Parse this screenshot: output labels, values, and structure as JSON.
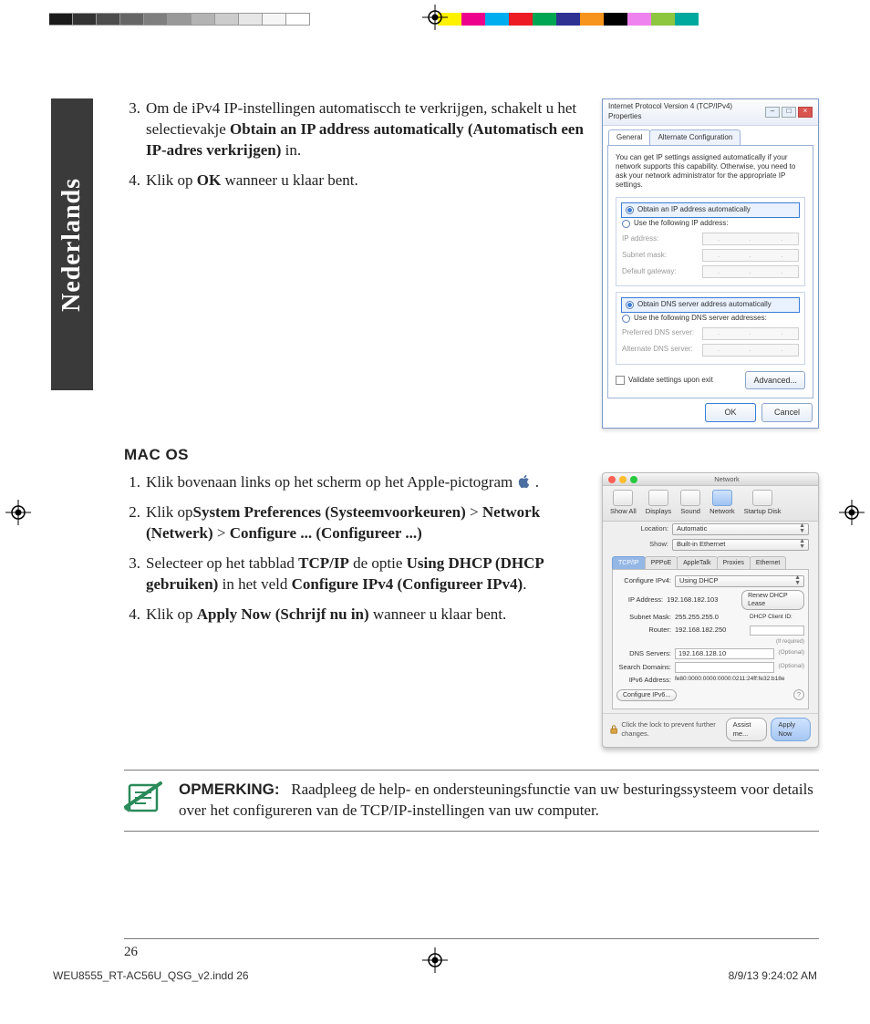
{
  "language_tab": "Nederlands",
  "page_number": "26",
  "win_section": {
    "step3_pre": "Om de iPv4 IP-instellingen automatiscch te verkrijgen, schakelt u het selectievakje ",
    "step3_bold": "Obtain an IP address automatically (Automatisch een IP-adres verkrijgen)",
    "step3_post": " in.",
    "step4_pre": "Klik op ",
    "step4_bold": "OK",
    "step4_post": " wanneer u klaar bent."
  },
  "mac_heading": "MAC OS",
  "mac_section": {
    "step1": "Klik bovenaan links op het scherm op het Apple-pictogram ",
    "step1_post": ".",
    "step2_pre": "Klik op",
    "step2_b1": "System Preferences (Systeemvoorkeuren)",
    "gt": " > ",
    "step2_b2": "Network (Netwerk)",
    "step2_b3": "Configure ... (Configureer ...)",
    "step3_pre": "Selecteer op het tabblad ",
    "step3_b1": "TCP/IP",
    "step3_mid": " de optie ",
    "step3_b2": "Using DHCP (DHCP gebruiken)",
    "step3_mid2": " in het veld ",
    "step3_b3": "Configure IPv4 (Configureer IPv4)",
    "step3_post": ".",
    "step4_pre": "Klik op ",
    "step4_b": "Apply Now (Schrijf nu in)",
    "step4_post": " wanneer u klaar bent."
  },
  "note": {
    "label": "OPMERKING:",
    "text": "Raadpleeg de help- en ondersteuningsfunctie van uw besturingssysteem voor details over het configureren van de TCP/IP-instellingen van uw computer."
  },
  "slug": {
    "file": "WEU8555_RT-AC56U_QSG_v2.indd   26",
    "timestamp": "8/9/13   9:24:02 AM"
  },
  "win_dialog": {
    "title": "Internet Protocol Version 4 (TCP/IPv4) Properties",
    "tab_general": "General",
    "tab_alt": "Alternate Configuration",
    "desc": "You can get IP settings assigned automatically if your network supports this capability. Otherwise, you need to ask your network administrator for the appropriate IP settings.",
    "r_obtain_ip": "Obtain an IP address automatically",
    "r_use_ip": "Use the following IP address:",
    "f_ip": "IP address:",
    "f_subnet": "Subnet mask:",
    "f_gateway": "Default gateway:",
    "r_obtain_dns": "Obtain DNS server address automatically",
    "r_use_dns": "Use the following DNS server addresses:",
    "f_pref_dns": "Preferred DNS server:",
    "f_alt_dns": "Alternate DNS server:",
    "chk_validate": "Validate settings upon exit",
    "btn_adv": "Advanced...",
    "btn_ok": "OK",
    "btn_cancel": "Cancel"
  },
  "mac_dialog": {
    "window_title": "Network",
    "toolbar": {
      "show_all": "Show All",
      "displays": "Displays",
      "sound": "Sound",
      "network": "Network",
      "startup": "Startup Disk"
    },
    "loc_label": "Location:",
    "loc_value": "Automatic",
    "show_label": "Show:",
    "show_value": "Built-in Ethernet",
    "tabs": {
      "tcpip": "TCP/IP",
      "pppoe": "PPPoE",
      "appletalk": "AppleTalk",
      "proxies": "Proxies",
      "ethernet": "Ethernet"
    },
    "cfg_label": "Configure IPv4:",
    "cfg_value": "Using DHCP",
    "ip": "IP Address:",
    "ip_v": "192.168.182.103",
    "subnet": "Subnet Mask:",
    "subnet_v": "255.255.255.0",
    "router": "Router:",
    "router_v": "192.168.182.250",
    "dns": "DNS Servers:",
    "dns_v": "192.168.128.10",
    "search": "Search Domains:",
    "ipv6": "IPv6 Address:",
    "ipv6_v": "fe80:0000:0000:0000:0211:24ff:fe32:b18e",
    "renew": "Renew DHCP Lease",
    "client_id": "DHCP Client ID:",
    "client_hint": "(If required)",
    "optional": "(Optional)",
    "cfg_ipv6": "Configure IPv6...",
    "lock": "Click the lock to prevent further changes.",
    "assist": "Assist me...",
    "apply": "Apply Now"
  },
  "colors": {
    "gray_strip": [
      "#1a1a1a",
      "#333333",
      "#4d4d4d",
      "#666666",
      "#7f7f7f",
      "#999999",
      "#b3b3b3",
      "#cccccc",
      "#e6e6e6",
      "#f5f5f5",
      "#ffffff"
    ],
    "hue_strip": [
      "#fff200",
      "#ec008c",
      "#00aeef",
      "#ed1c24",
      "#00a651",
      "#2e3192",
      "#f7941d",
      "#000000",
      "#ee82ee",
      "#8dc63f",
      "#00a99d"
    ]
  }
}
